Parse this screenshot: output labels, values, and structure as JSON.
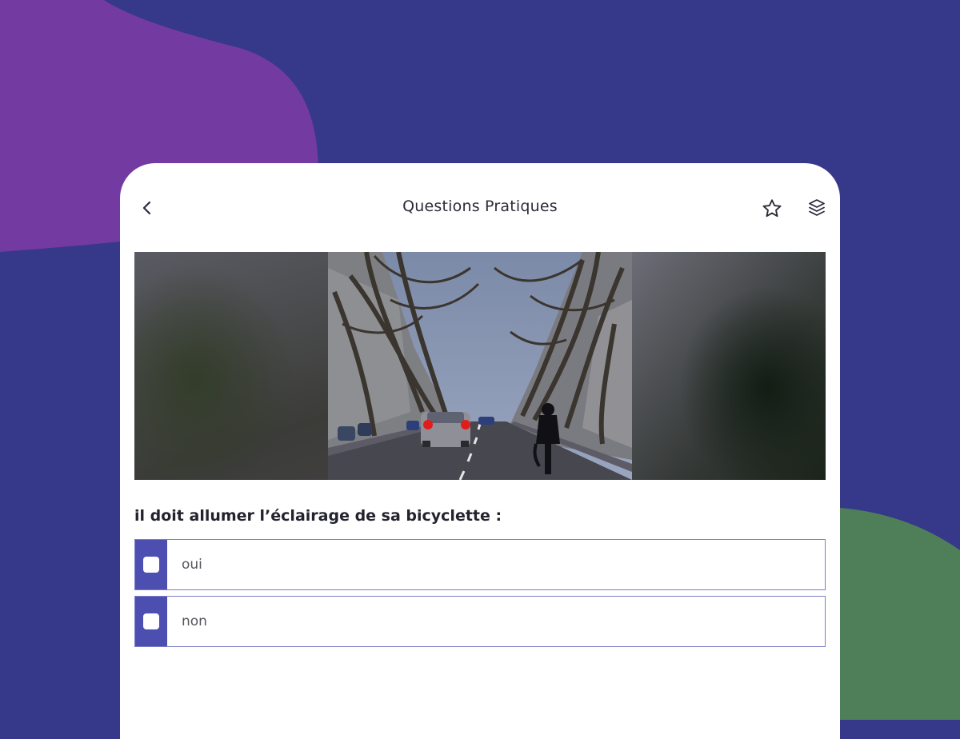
{
  "header": {
    "title": "Questions Pratiques",
    "back_icon": "chevron-left-icon",
    "favorite_icon": "star-icon",
    "layers_icon": "layers-icon"
  },
  "media": {
    "scene": "night city street with car and cyclist"
  },
  "question": {
    "text": "il doit allumer l’éclairage de sa bicyclette :"
  },
  "answers": [
    {
      "label": "oui",
      "checked": false
    },
    {
      "label": "non",
      "checked": false
    }
  ],
  "colors": {
    "background": "#36388a",
    "blob_purple": "#733aa2",
    "blob_green": "#4f7f58",
    "answer_tab": "#4c4fb0",
    "answer_border": "#7b7fc8"
  }
}
